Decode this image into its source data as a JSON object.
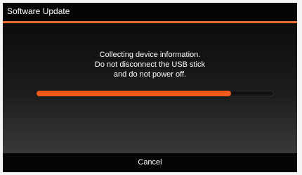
{
  "dialog": {
    "title": "Software Update",
    "message": [
      "Collecting device information.",
      "Do not disconnect the USB stick",
      "and do not power off."
    ],
    "progress": 0.82,
    "cancel_label": "Cancel"
  },
  "colors": {
    "accent": "#f06a2a",
    "progress_fill": "#f05a1c"
  }
}
